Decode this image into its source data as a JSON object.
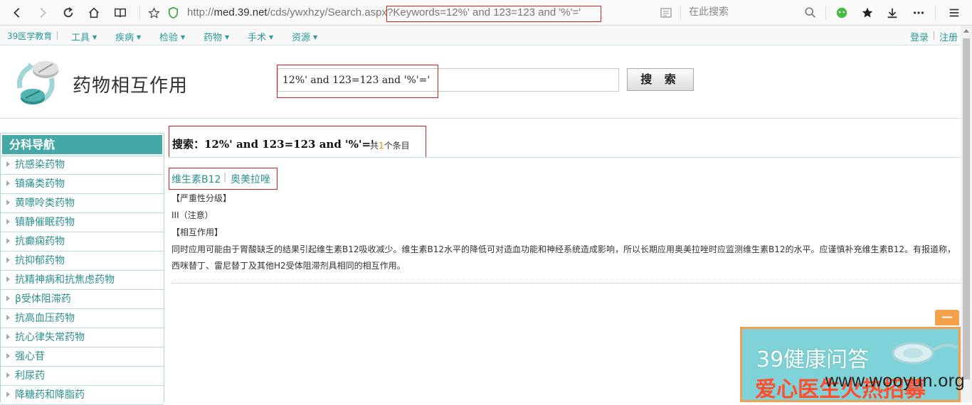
{
  "browser": {
    "url_domain_prefix": "http://",
    "url_domain": "med.39.net",
    "url_path": "/cds/ywxhzy/Search.aspx",
    "url_query": "?Keywords=12%' and 123=123 and '%'='",
    "search_placeholder": "在此搜索"
  },
  "site_nav": {
    "home": "39医学教育",
    "items": [
      {
        "label": "工具"
      },
      {
        "label": "疾病"
      },
      {
        "label": "检验"
      },
      {
        "label": "药物"
      },
      {
        "label": "手术"
      },
      {
        "label": "资源"
      }
    ],
    "login": "登录",
    "register": "注册"
  },
  "header": {
    "title": "药物相互作用",
    "search_value": "12%' and 123=123 and '%'='",
    "search_button": "搜 索"
  },
  "sidebar": {
    "title": "分科导航",
    "items": [
      {
        "label": "抗感染药物"
      },
      {
        "label": "镇痛类药物"
      },
      {
        "label": "黄嘌呤类药物"
      },
      {
        "label": "镇静催眠药物"
      },
      {
        "label": "抗癫痫药物"
      },
      {
        "label": "抗抑郁药物"
      },
      {
        "label": "抗精神病和抗焦虑药物"
      },
      {
        "label": "β受体阻滞药"
      },
      {
        "label": "抗高血压药物"
      },
      {
        "label": "抗心律失常药物"
      },
      {
        "label": "强心苷"
      },
      {
        "label": "利尿药"
      },
      {
        "label": "降糖药和降脂药"
      }
    ]
  },
  "result": {
    "heading": "搜索：12%' and 123=123 and '%'='",
    "count_prefix": "共",
    "count": "1",
    "count_suffix": "个条目",
    "drug_a": "维生素B12",
    "separator": "|",
    "drug_b": "奥美拉唑",
    "severity_label": "【严重性分级】",
    "severity_value": "III（注意）",
    "interaction_label": "【相互作用】",
    "interaction_text": "同时应用可能由于胃酸缺乏的结果引起维生素B12吸收减少。维生素B12水平的降低可对造血功能和神经系统造成影响，所以长期应用奥美拉唑时应监测维生素B12的水平。应谨慎补充维生素B12。有报道称，西咪替丁、雷尼替丁及其他H2受体阻滞剂具相同的相互作用。"
  },
  "ad": {
    "title": "39健康问答",
    "subtitle": "爱心医生火热招募",
    "close": "—"
  },
  "watermark": "www.wooyun.org",
  "colors": {
    "teal": "#45a8a7",
    "link": "#2b8f8e",
    "highlight_red": "#e02020"
  }
}
